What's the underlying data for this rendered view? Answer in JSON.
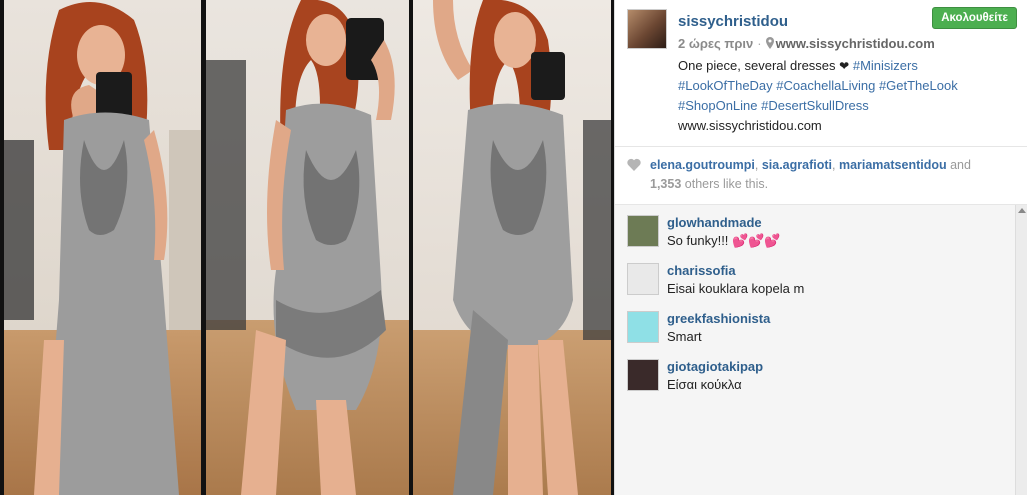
{
  "post": {
    "username": "sissychristidou",
    "follow_label": "Ακολουθείτε",
    "time_ago": "2 ώρες πριν",
    "location_link": "www.sissychristidou.com",
    "caption": {
      "text_before": "One piece, several dresses",
      "heart": "❤",
      "hashtags": [
        "#Minisizers",
        "#LookOfTheDay",
        "#CoachellaLiving",
        "#GetTheLook",
        "#ShopOnLine",
        "#DesertSkullDress"
      ],
      "footer_link": "www.sissychristidou.com"
    }
  },
  "likes": {
    "users": [
      "elena.goutroumpi",
      "sia.agrafioti",
      "mariamatsentidou"
    ],
    "and_word": "and",
    "others_count": "1,353",
    "others_text": "others like this."
  },
  "comments": [
    {
      "user": "glowhandmade",
      "text": "So funky!!! 💕💕💕",
      "avatar_color": "#6d7b55"
    },
    {
      "user": "charissofia",
      "text": "Eisai kouklara kopela m",
      "avatar_color": "#e9e9e9"
    },
    {
      "user": "greekfashionista",
      "text": "Smart",
      "avatar_color": "#8fe0e6"
    },
    {
      "user": "giotagiotakipap",
      "text": "Είσαι κούκλα",
      "avatar_color": "#3a2a2a"
    }
  ],
  "colors": {
    "link": "#3b6ea5",
    "username": "#2f5f8c",
    "follow_button": "#4caf50"
  }
}
